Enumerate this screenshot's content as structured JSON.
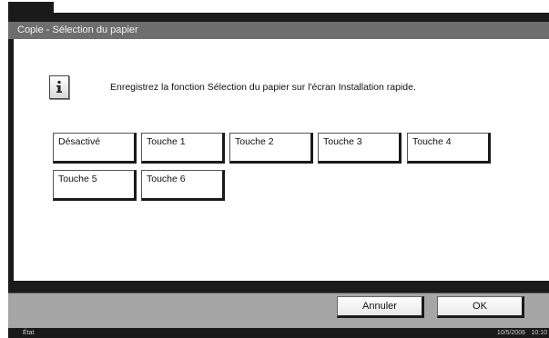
{
  "window": {
    "title": "Copie - Sélection du papier"
  },
  "info": {
    "icon": "info-icon",
    "message": "Enregistrez la fonction Sélection du papier sur l'écran Installation rapide."
  },
  "options": [
    {
      "label": "Désactivé"
    },
    {
      "label": "Touche 1"
    },
    {
      "label": "Touche 2"
    },
    {
      "label": "Touche 3"
    },
    {
      "label": "Touche 4"
    },
    {
      "label": "Touche 5"
    },
    {
      "label": "Touche 6"
    }
  ],
  "actions": {
    "cancel_label": "Annuler",
    "ok_label": "OK"
  },
  "status_bar": {
    "label": "État",
    "date": "10/5/2006",
    "time": "10:10"
  },
  "colors": {
    "frame": "#1a1a1a",
    "title_bar": "#6e6e6e",
    "bottom_bar": "#a6a6a6"
  }
}
